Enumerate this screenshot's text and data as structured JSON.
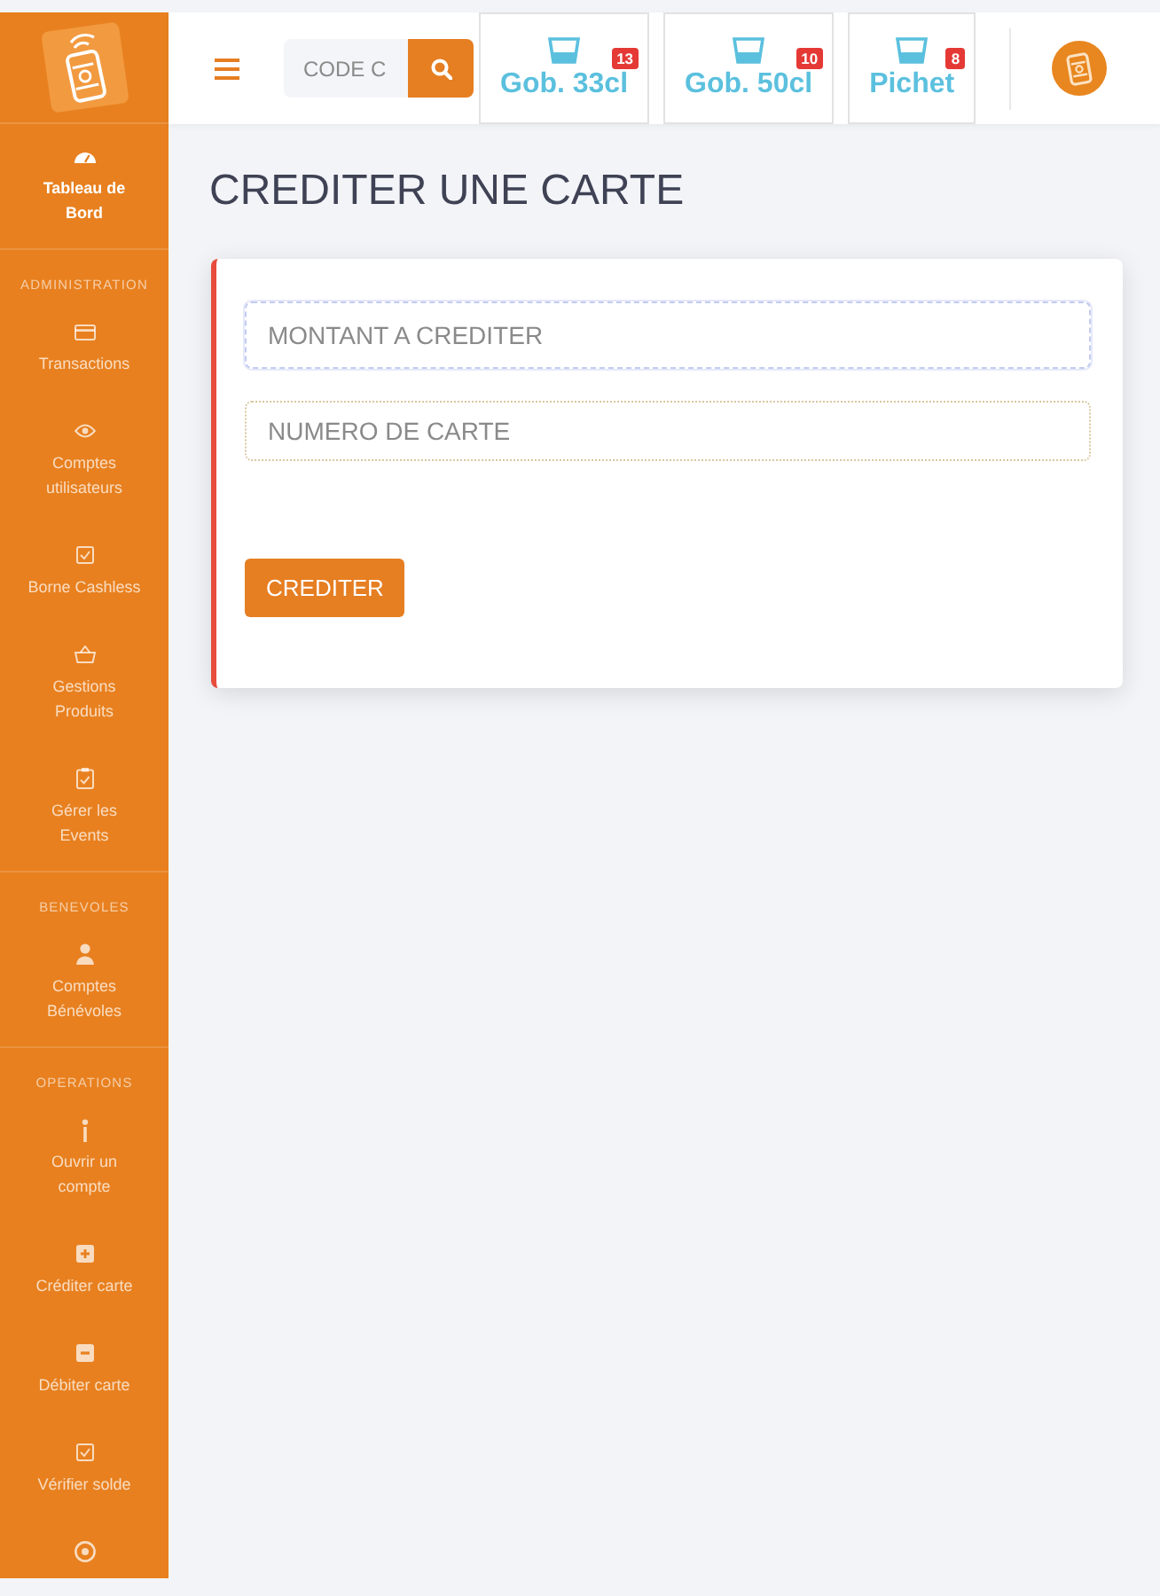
{
  "sidebar": {
    "sections": [
      {
        "items": [
          {
            "label": "Tableau de Bord",
            "selected": true
          }
        ]
      },
      {
        "heading": "ADMINISTRATION",
        "items": [
          {
            "label": "Transactions",
            "selected": false
          },
          {
            "label": "Comptes utilisateurs",
            "selected": false
          },
          {
            "label": "Borne Cashless",
            "selected": false
          },
          {
            "label": "Gestions Produits",
            "selected": false
          },
          {
            "label": "Gérer les Events",
            "selected": false
          }
        ]
      },
      {
        "heading": "BENEVOLES",
        "items": [
          {
            "label": "Comptes Bénévoles",
            "selected": false
          }
        ]
      },
      {
        "heading": "OPERATIONS",
        "items": [
          {
            "label": "Ouvrir un compte",
            "selected": false
          },
          {
            "label": "Créditer carte",
            "selected": false
          },
          {
            "label": "Débiter carte",
            "selected": false
          },
          {
            "label": "Vérifier solde",
            "selected": false
          },
          {
            "selected": false
          }
        ]
      }
    ]
  },
  "header": {
    "search": {
      "placeholder": "CODE C"
    },
    "products": [
      {
        "name": "Gob. 33cl",
        "count": "13"
      },
      {
        "name": "Gob. 50cl",
        "count": "10"
      },
      {
        "name": "Pichet",
        "count": "8"
      }
    ]
  },
  "page": {
    "title": "CREDITER UNE CARTE",
    "form": {
      "fields": [
        {
          "placeholder": "MONTANT A CREDITER",
          "focused": true
        },
        {
          "placeholder": "NUMERO DE CARTE",
          "focused": false
        }
      ],
      "submit": "CREDITER"
    }
  }
}
